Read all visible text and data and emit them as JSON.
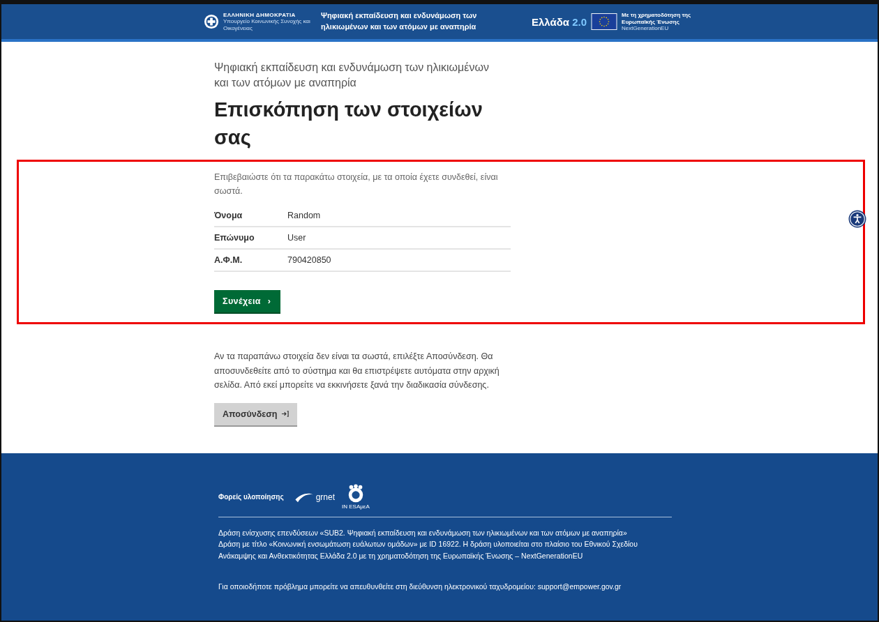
{
  "header": {
    "ministry_title": "ΕΛΛΗΝΙΚΗ ΔΗΜΟΚΡΑΤΙΑ",
    "ministry_name": "Υπουργείο Κοινωνικής Συνοχής και Οικογένειας",
    "site_title": "Ψηφιακή εκπαίδευση και ενδυνάμωση των ηλικιωμένων και των ατόμων με αναπηρία",
    "brand": "Ελλάδα",
    "brand_version": "2.0",
    "eu_funding": "Με τη χρηματοδότηση της Ευρωπαϊκής Ένωσης",
    "eu_program": "NextGenerationEU"
  },
  "page": {
    "subtitle": "Ψηφιακή εκπαίδευση και ενδυνάμωση των ηλικιωμένων και των ατόμων με αναπηρία",
    "title": "Επισκόπηση των στοιχείων σας",
    "intro": "Επιβεβαιώστε ότι τα παρακάτω στοιχεία, με τα οποία έχετε συνδεθεί, είναι σωστά.",
    "details": [
      {
        "label": "Όνομα",
        "value": "Random"
      },
      {
        "label": "Επώνυμο",
        "value": "User"
      },
      {
        "label": "Α.Φ.Μ.",
        "value": "790420850"
      }
    ],
    "continue_button": "Συνέχεια",
    "continue_icon": "›",
    "logout_text": "Αν τα παραπάνω στοιχεία δεν είναι τα σωστά, επιλέξτε Αποσύνδεση. Θα αποσυνδεθείτε από το σύστημα και θα επιστρέψετε αυτόματα στην αρχική σελίδα. Από εκεί μπορείτε να εκκινήσετε ξανά την διαδικασία σύνδεσης.",
    "logout_button": "Αποσύνδεση"
  },
  "footer": {
    "partners_label": "Φορείς υλοποίησης",
    "partner_grnet": "grnet",
    "partner_inesamea": "IN ESAμεA",
    "description": [
      "Δράση ενίσχυσης επενδύσεων «SUB2. Ψηφιακή εκπαίδευση και ενδυνάμωση των ηλικιωμένων και των ατόμων με αναπηρία»",
      "Δράση με τίτλο «Κοινωνική ενσωμάτωση ευάλωτων ομάδων» με ID 16922. Η δράση υλοποιείται στο πλαίσιο του Εθνικού Σχεδίου Ανάκαμψης και Ανθεκτικότητας Ελλάδα 2.0 με τη χρηματοδότηση της Ευρωπαϊκής Ένωσης – NextGenerationEU"
    ],
    "contact": "Για οποιοδήποτε πρόβλημα μπορείτε να απευθυνθείτε στη διεύθυνση ηλεκτρονικού ταχυδρομείου: support@empower.gov.gr"
  }
}
